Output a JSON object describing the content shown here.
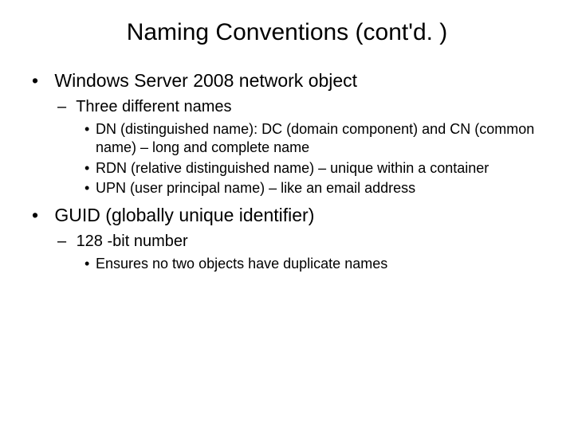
{
  "title": "Naming Conventions (cont'd. )",
  "bullets": [
    {
      "text": "Windows Server 2008 network object",
      "children": [
        {
          "text": "Three different names",
          "children": [
            {
              "text": "DN (distinguished name): DC (domain component) and CN (common name) – long and complete name"
            },
            {
              "text": "RDN (relative distinguished name) – unique within a container"
            },
            {
              "text": "UPN (user principal name) – like an email address"
            }
          ]
        }
      ]
    },
    {
      "text": "GUID (globally unique identifier)",
      "children": [
        {
          "text": "128 -bit number",
          "children": [
            {
              "text": "Ensures no two objects have duplicate names"
            }
          ]
        }
      ]
    }
  ]
}
